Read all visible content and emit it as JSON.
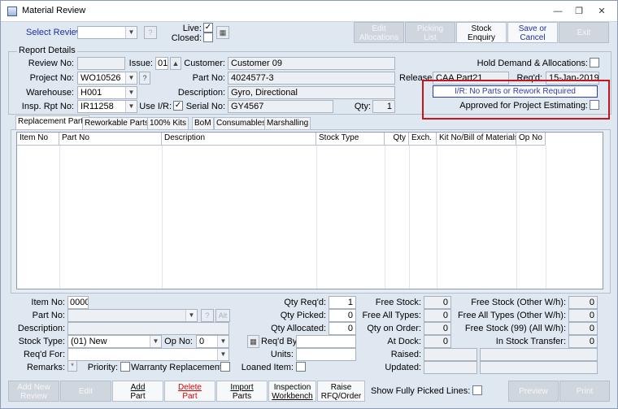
{
  "window": {
    "title": "Material Review"
  },
  "toolbar": {
    "select_review_label": "Select Review:",
    "select_review_value": "",
    "live_label": "Live:",
    "live_checked": true,
    "closed_label": "Closed:",
    "closed_checked": false,
    "edit_allocations": [
      "Edit",
      "Allocations"
    ],
    "picking_list": [
      "Picking",
      "List"
    ],
    "stock_enquiry": [
      "Stock",
      "Enquiry"
    ],
    "save_or_cancel": [
      "Save or",
      "Cancel"
    ],
    "exit": "Exit"
  },
  "report": {
    "group_title": "Report Details",
    "review_no_label": "Review No:",
    "review_no": "",
    "issue_label": "Issue:",
    "issue": "01",
    "project_no_label": "Project No:",
    "project_no": "WO10526",
    "warehouse_label": "Warehouse:",
    "warehouse": "H001",
    "insp_rpt_no_label": "Insp. Rpt No:",
    "insp_rpt_no": "IR11258",
    "use_ir_label": "Use I/R:",
    "use_ir_checked": true,
    "customer_label": "Customer:",
    "customer": "Customer 09",
    "part_no_label": "Part No:",
    "part_no": "4024577-3",
    "description_label": "Description:",
    "description": "Gyro, Directional",
    "serial_no_label": "Serial No:",
    "serial_no": "GY4567",
    "qty_label": "Qty:",
    "qty": "1",
    "release_label": "Release:",
    "release": "CAA Part21",
    "reqd_label": "Req'd:",
    "reqd": "15-Jan-2019",
    "hold_demand_label": "Hold Demand & Allocations:",
    "hold_demand_checked": false,
    "ir_status": "I/R: No Parts or Rework Required",
    "approved_label": "Approved for Project Estimating:",
    "approved_checked": false
  },
  "tabs": [
    {
      "label": "Replacement Parts",
      "active": true
    },
    {
      "label": "Reworkable Parts",
      "active": false
    },
    {
      "label": "100% Kits",
      "active": false
    },
    {
      "label": "BoM",
      "active": false
    },
    {
      "label": "Consumables",
      "active": false
    },
    {
      "label": "Marshalling",
      "active": false
    }
  ],
  "grid": {
    "columns": [
      "Item No",
      "Part No",
      "Description",
      "Stock Type",
      "Qty",
      "Exch.",
      "Kit No/Bill of Materials",
      "Op No"
    ],
    "rows": []
  },
  "item": {
    "item_no_label": "Item No:",
    "item_no": "0000",
    "part_no_label": "Part No:",
    "part_no": "",
    "description_label": "Description:",
    "description": "",
    "stock_type_label": "Stock Type:",
    "stock_type": "(01) New",
    "op_no_label": "Op No:",
    "op_no": "0",
    "reqd_for_label": "Req'd For:",
    "reqd_for": "",
    "remarks_label": "Remarks:",
    "priority_label": "Priority:",
    "warranty_label": "Warranty Replacement:",
    "qty_reqd_label": "Qty Req'd:",
    "qty_reqd": "1",
    "qty_picked_label": "Qty Picked:",
    "qty_picked": "0",
    "qty_allocated_label": "Qty Allocated:",
    "qty_allocated": "0",
    "reqd_by_label": "Req'd By:",
    "reqd_by": "",
    "units_label": "Units:",
    "units": "",
    "loaned_item_label": "Loaned Item:",
    "free_stock_label": "Free Stock:",
    "free_stock": "0",
    "free_all_types_label": "Free All Types:",
    "free_all_types": "0",
    "qty_on_order_label": "Qty on Order:",
    "qty_on_order": "0",
    "at_dock_label": "At Dock:",
    "at_dock": "0",
    "raised_label": "Raised:",
    "updated_label": "Updated:",
    "free_stock_other_label": "Free Stock (Other W/h):",
    "free_stock_other": "0",
    "free_all_types_other_label": "Free All Types (Other W/h):",
    "free_all_types_other": "0",
    "free_stock_99_label": "Free Stock (99) (All W/h):",
    "free_stock_99": "0",
    "in_stock_transfer_label": "In Stock Transfer:",
    "in_stock_transfer": "0"
  },
  "bottom": {
    "add_new_review": [
      "Add New",
      "Review"
    ],
    "edit": "Edit",
    "add_part": [
      "Add",
      "Part"
    ],
    "delete_part": [
      "Delete",
      "Part"
    ],
    "import_parts": [
      "Import",
      "Parts"
    ],
    "inspection_workbench": [
      "Inspection",
      "Workbench"
    ],
    "raise_rfq": [
      "Raise",
      "RFQ/Order"
    ],
    "show_fully_picked_label": "Show Fully Picked Lines:",
    "show_fully_picked_checked": false,
    "preview": "Preview",
    "print": "Print"
  }
}
